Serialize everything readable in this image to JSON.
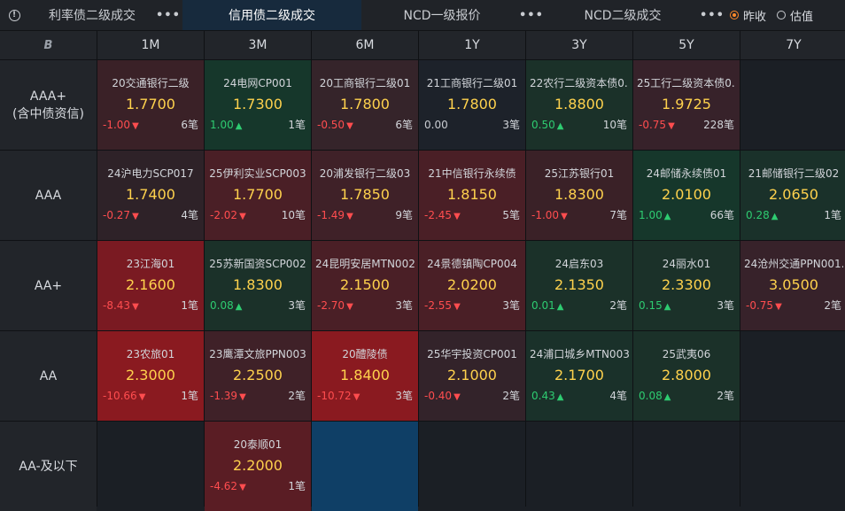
{
  "tabs": [
    {
      "label": "利率债二级成交",
      "active": false
    },
    {
      "label": "信用债二级成交",
      "active": true
    },
    {
      "label": "NCD一级报价",
      "active": false
    },
    {
      "label": "NCD二级成交",
      "active": false
    }
  ],
  "more_glyph": "•••",
  "radios": [
    {
      "label": "昨收",
      "checked": true
    },
    {
      "label": "估值",
      "checked": false
    }
  ],
  "corner_icon": "B",
  "columns": [
    "1M",
    "3M",
    "6M",
    "1Y",
    "3Y",
    "5Y",
    "7Y"
  ],
  "rows": [
    {
      "label_line1": "AAA+",
      "label_line2": "(含中债资信)"
    },
    {
      "label_line1": "AAA",
      "label_line2": ""
    },
    {
      "label_line1": "AA+",
      "label_line2": ""
    },
    {
      "label_line1": "AA",
      "label_line2": ""
    },
    {
      "label_line1": "AA-及以下",
      "label_line2": ""
    }
  ],
  "cells": [
    [
      {
        "name": "20交通银行二级",
        "yield": "1.7700",
        "change": "-1.00",
        "dir": "down",
        "count": "6笔",
        "bg": "#3a2127"
      },
      {
        "name": "24电网CP001",
        "yield": "1.7300",
        "change": "1.00",
        "dir": "up",
        "count": "1笔",
        "bg": "#16372b"
      },
      {
        "name": "20工商银行二级01",
        "yield": "1.7800",
        "change": "-0.50",
        "dir": "down",
        "count": "6笔",
        "bg": "#35242a"
      },
      {
        "name": "21工商银行二级01",
        "yield": "1.7800",
        "change": "0.00",
        "dir": "none",
        "count": "3笔",
        "bg": "#1d222a"
      },
      {
        "name": "22农行二级资本债0...",
        "yield": "1.8800",
        "change": "0.50",
        "dir": "up",
        "count": "10笔",
        "bg": "#1b3129"
      },
      {
        "name": "25工行二级资本债0...",
        "yield": "1.9725",
        "change": "-0.75",
        "dir": "down",
        "count": "228笔",
        "bg": "#37222a"
      },
      null
    ],
    [
      {
        "name": "24沪电力SCP017",
        "yield": "1.7400",
        "change": "-0.27",
        "dir": "down",
        "count": "4笔",
        "bg": "#2e2228"
      },
      {
        "name": "25伊利实业SCP003",
        "yield": "1.7700",
        "change": "-2.02",
        "dir": "down",
        "count": "10笔",
        "bg": "#4a1f26"
      },
      {
        "name": "20浦发银行二级03",
        "yield": "1.7850",
        "change": "-1.49",
        "dir": "down",
        "count": "9笔",
        "bg": "#3f2128"
      },
      {
        "name": "21中信银行永续债",
        "yield": "1.8150",
        "change": "-2.45",
        "dir": "down",
        "count": "5笔",
        "bg": "#4a1f26"
      },
      {
        "name": "25江苏银行01",
        "yield": "1.8300",
        "change": "-1.00",
        "dir": "down",
        "count": "7笔",
        "bg": "#3a2127"
      },
      {
        "name": "24邮储永续债01",
        "yield": "2.0100",
        "change": "1.00",
        "dir": "up",
        "count": "66笔",
        "bg": "#16372b"
      },
      {
        "name": "21邮储银行二级02",
        "yield": "2.0650",
        "change": "0.28",
        "dir": "up",
        "count": "1笔",
        "bg": "#1a312a"
      }
    ],
    [
      {
        "name": "23江海01",
        "yield": "2.1600",
        "change": "-8.43",
        "dir": "down",
        "count": "1笔",
        "bg": "#7a1a22"
      },
      {
        "name": "25苏新国资SCP002",
        "yield": "1.8300",
        "change": "0.08",
        "dir": "up",
        "count": "3笔",
        "bg": "#1b3129"
      },
      {
        "name": "24昆明安居MTN002",
        "yield": "2.1500",
        "change": "-2.70",
        "dir": "down",
        "count": "3笔",
        "bg": "#4a1f26"
      },
      {
        "name": "24景德镇陶CP004",
        "yield": "2.0200",
        "change": "-2.55",
        "dir": "down",
        "count": "3笔",
        "bg": "#4a1f26"
      },
      {
        "name": "24启东03",
        "yield": "2.1350",
        "change": "0.01",
        "dir": "up",
        "count": "2笔",
        "bg": "#1b3129"
      },
      {
        "name": "24丽水01",
        "yield": "2.3300",
        "change": "0.15",
        "dir": "up",
        "count": "3笔",
        "bg": "#1b3129"
      },
      {
        "name": "24沧州交通PPN001...",
        "yield": "3.0500",
        "change": "-0.75",
        "dir": "down",
        "count": "2笔",
        "bg": "#37222a"
      }
    ],
    [
      {
        "name": "23农旅01",
        "yield": "2.3000",
        "change": "-10.66",
        "dir": "down",
        "count": "1笔",
        "bg": "#8a1a20"
      },
      {
        "name": "23鹰潭文旅PPN003",
        "yield": "2.2500",
        "change": "-1.39",
        "dir": "down",
        "count": "2笔",
        "bg": "#3f2128"
      },
      {
        "name": "20醴陵债",
        "yield": "1.8400",
        "change": "-10.72",
        "dir": "down",
        "count": "3笔",
        "bg": "#8a1a20"
      },
      {
        "name": "25华宇投资CP001",
        "yield": "2.1000",
        "change": "-0.40",
        "dir": "down",
        "count": "2笔",
        "bg": "#33232a"
      },
      {
        "name": "24浦口城乡MTN003",
        "yield": "2.1700",
        "change": "0.43",
        "dir": "up",
        "count": "4笔",
        "bg": "#1a312a"
      },
      {
        "name": "25武夷06",
        "yield": "2.8000",
        "change": "0.08",
        "dir": "up",
        "count": "2笔",
        "bg": "#1b3129"
      },
      null
    ],
    [
      null,
      {
        "name": "20泰顺01",
        "yield": "2.2000",
        "change": "-4.62",
        "dir": "down",
        "count": "1笔",
        "bg": "#5a1d24"
      },
      "blue",
      null,
      null,
      null,
      null
    ]
  ]
}
